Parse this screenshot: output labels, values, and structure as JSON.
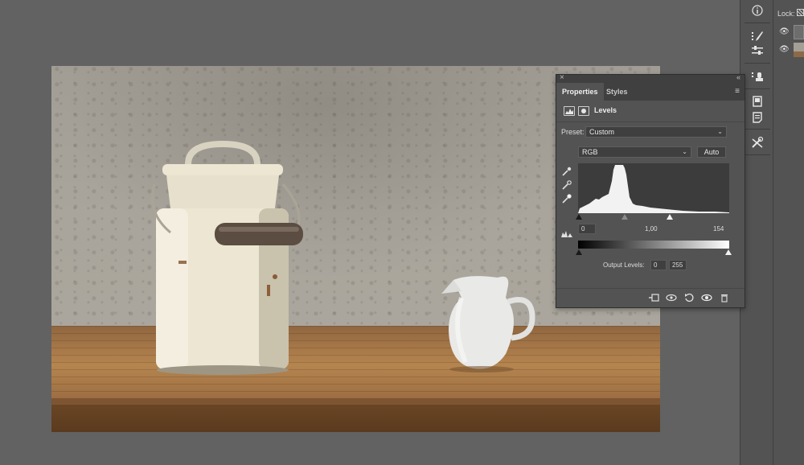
{
  "tool_strip": {
    "icons": [
      "info-icon",
      "brush-settings-icon",
      "adjustments-icon",
      "clone-source-icon",
      "libraries-icon",
      "notes-icon",
      "tool-presets-icon"
    ]
  },
  "layers": {
    "lock_label": "Lock:"
  },
  "properties_panel": {
    "tabs": [
      {
        "label": "Properties",
        "active": true
      },
      {
        "label": "Styles",
        "active": false
      }
    ],
    "adjustment_title": "Levels",
    "preset_label": "Preset:",
    "preset_value": "Custom",
    "channel_value": "RGB",
    "auto_label": "Auto",
    "input_levels": {
      "black": "0",
      "midtone": "1,00",
      "white": "154"
    },
    "output_label": "Output Levels:",
    "output_levels": {
      "black": "0",
      "white": "255"
    }
  },
  "colors": {
    "panel_bg": "#535353",
    "canvas_bg": "#626262",
    "tab_bar": "#404040"
  }
}
